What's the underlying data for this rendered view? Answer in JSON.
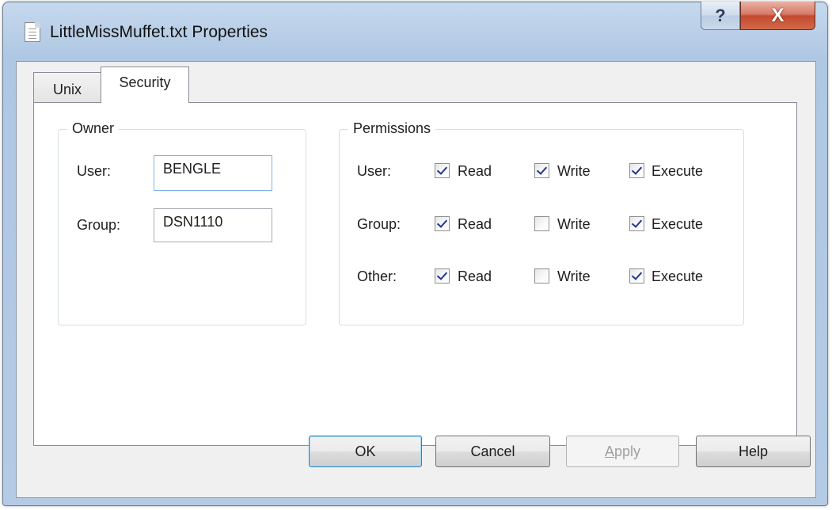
{
  "window": {
    "title": "LittleMissMuffet.txt Properties",
    "help_symbol": "?",
    "close_symbol": "X"
  },
  "tabs": [
    {
      "label": "Unix",
      "selected": false
    },
    {
      "label": "Security",
      "selected": true
    }
  ],
  "owner": {
    "legend": "Owner",
    "user_label": "User:",
    "user_value": "BENGLE",
    "group_label": "Group:",
    "group_value": "DSN1110"
  },
  "permissions": {
    "legend": "Permissions",
    "read_label": "Read",
    "write_label": "Write",
    "execute_label": "Execute",
    "rows": [
      {
        "label": "User:",
        "read": true,
        "write": true,
        "execute": true
      },
      {
        "label": "Group:",
        "read": true,
        "write": false,
        "execute": true
      },
      {
        "label": "Other:",
        "read": true,
        "write": false,
        "execute": true
      }
    ]
  },
  "buttons": {
    "ok": "OK",
    "cancel": "Cancel",
    "apply_accel": "A",
    "apply_rest": "pply",
    "help": "Help"
  },
  "colors": {
    "titlebar": "#b9cfe7",
    "close_button": "#c44a30",
    "dialog_background": "#f0f0f0",
    "checkmark": "#21358f"
  }
}
